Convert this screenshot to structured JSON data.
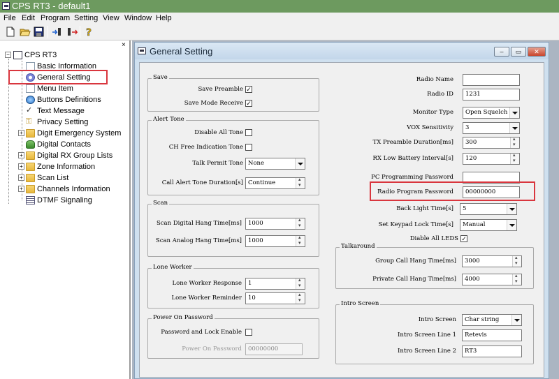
{
  "app": {
    "title": "CPS RT3 - default1",
    "colors": {
      "titlebar": "#6d9a5f",
      "highlight_box": "#d9363e",
      "mdi_background": "#abb5c2"
    }
  },
  "menu": [
    "File",
    "Edit",
    "Program",
    "Setting",
    "View",
    "Window",
    "Help"
  ],
  "toolbar": {
    "icons": [
      "new-file-icon",
      "open-folder-icon",
      "save-icon",
      "read-radio-icon",
      "write-radio-icon",
      "help-icon"
    ]
  },
  "tree": {
    "close_glyph": "×",
    "root": "CPS RT3",
    "items": [
      {
        "label": "Basic Information",
        "icon": "page-icon"
      },
      {
        "label": "General Setting",
        "icon": "gear-icon"
      },
      {
        "label": "Menu Item",
        "icon": "page-icon"
      },
      {
        "label": "Buttons Definitions",
        "icon": "button-icon"
      },
      {
        "label": "Text Message",
        "icon": "check-icon"
      },
      {
        "label": "Privacy Setting",
        "icon": "key-icon"
      },
      {
        "label": "Digit Emergency System",
        "icon": "folder-icon"
      },
      {
        "label": "Digital Contacts",
        "icon": "contacts-icon"
      },
      {
        "label": "Digital RX Group Lists",
        "icon": "folder-icon"
      },
      {
        "label": "Zone Information",
        "icon": "folder-icon"
      },
      {
        "label": "Scan List",
        "icon": "folder-icon"
      },
      {
        "label": "Channels Information",
        "icon": "folder-icon"
      },
      {
        "label": "DTMF Signaling",
        "icon": "list-icon"
      }
    ]
  },
  "window": {
    "title": "General Setting",
    "buttons": {
      "minimize": "–",
      "restore": "▭",
      "close": "✕"
    }
  },
  "form": {
    "save": {
      "legend": "Save",
      "save_preamble": {
        "label": "Save Preamble",
        "checked": "✓"
      },
      "save_mode_receive": {
        "label": "Save Mode Receive",
        "checked": "✓"
      }
    },
    "alert_tone": {
      "legend": "Alert Tone",
      "disable_all_tone": {
        "label": "Disable All Tone",
        "checked": ""
      },
      "ch_free_indication_tone": {
        "label": "CH Free Indication Tone",
        "checked": ""
      },
      "talk_permit_tone": {
        "label": "Talk Permit Tone",
        "value": "None"
      },
      "call_alert_tone_duration": {
        "label": "Call Alert Tone Duration[s]",
        "value": "Continue"
      }
    },
    "scan": {
      "legend": "Scan",
      "digital_hang_time": {
        "label": "Scan Digital Hang Time[ms]",
        "value": "1000"
      },
      "analog_hang_time": {
        "label": "Scan Analog Hang Time[ms]",
        "value": "1000"
      }
    },
    "lone_worker": {
      "legend": "Lone Worker",
      "response": {
        "label": "Lone Worker Response",
        "value": "1"
      },
      "reminder": {
        "label": "Lone Worker Reminder",
        "value": "10"
      }
    },
    "power_on_password": {
      "legend": "Power On Password",
      "password_lock_enable": {
        "label": "Password and Lock Enable",
        "checked": ""
      },
      "password": {
        "label": "Power On Password",
        "value": "00000000"
      }
    },
    "radio": {
      "radio_name": {
        "label": "Radio Name",
        "value": ""
      },
      "radio_id": {
        "label": "Radio ID",
        "value": "1231"
      },
      "monitor_type": {
        "label": "Monitor Type",
        "value": "Open Squelch"
      },
      "vox_sensitivity": {
        "label": "VOX Sensitivity",
        "value": "3"
      },
      "tx_preamble_duration": {
        "label": "TX Preamble Duration[ms]",
        "value": "300"
      },
      "rx_low_battery_interval": {
        "label": "RX Low Battery Interval[s]",
        "value": "120"
      },
      "pc_programming_password": {
        "label": "PC Programming Password",
        "value": ""
      },
      "radio_program_password": {
        "label": "Radio Program Password",
        "value": "00000000"
      },
      "back_light_time": {
        "label": "Back Light Time[s]",
        "value": "5"
      },
      "set_keypad_lock_time": {
        "label": "Set Keypad Lock Time[s]",
        "value": "Manual"
      },
      "disable_all_leds": {
        "label": "Diable All LEDS",
        "checked": "✓"
      }
    },
    "talkaround": {
      "legend": "Talkaround",
      "group_call_hang_time": {
        "label": "Group Call Hang Time[ms]",
        "value": "3000"
      },
      "private_call_hang_time": {
        "label": "Private Call Hang Time[ms]",
        "value": "4000"
      }
    },
    "intro_screen": {
      "legend": "Intro Screen",
      "intro_screen": {
        "label": "Intro Screen",
        "value": "Char string"
      },
      "line1": {
        "label": "Intro Screen Line 1",
        "value": "Retevis"
      },
      "line2": {
        "label": "Intro Screen Line 2",
        "value": "RT3"
      }
    }
  }
}
